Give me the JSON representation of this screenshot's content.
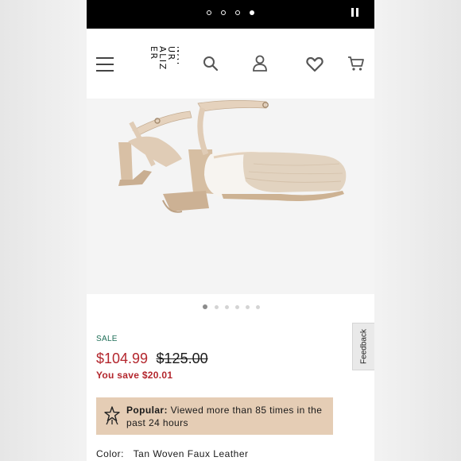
{
  "story_indicator": {
    "dots": 4,
    "active_index": 3,
    "pause_icon": "pause-icon"
  },
  "header": {
    "logo": {
      "rows": [
        "NAT",
        "UR",
        "ALIZ",
        "ER"
      ]
    },
    "icons": [
      "hamburger-menu-icon",
      "search-icon",
      "account-icon",
      "heart-icon",
      "cart-icon"
    ]
  },
  "product": {
    "image_alt": "Tan woven slingback block-heel pumps",
    "carousel": {
      "count": 6,
      "active_index": 0
    },
    "sale_label": "SALE",
    "price": "$104.99",
    "original_price": "$125.00",
    "savings": "You save $20.01",
    "popular": {
      "label": "Popular:",
      "text": " Viewed more than 85 times in the past 24 hours"
    },
    "color_label": "Color:",
    "color_value": "Tan Woven Faux Leather"
  },
  "feedback": {
    "label": "Feedback"
  },
  "colors": {
    "sale_green": "#1e6e57",
    "price_red": "#b3262d",
    "popular_bg": "#e5cdb5",
    "shoe_tan": "#e4d2bf"
  }
}
